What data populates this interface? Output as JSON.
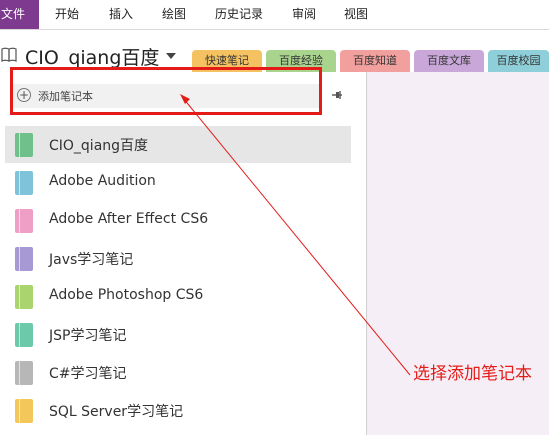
{
  "ribbon": {
    "file": "文件",
    "tabs": [
      "开始",
      "插入",
      "绘图",
      "历史记录",
      "审阅",
      "视图"
    ]
  },
  "notebook": {
    "title": "CIO_qiang百度"
  },
  "sections": [
    {
      "label": "快速笔记",
      "color": "#f5c262"
    },
    {
      "label": "百度经验",
      "color": "#a8d48d"
    },
    {
      "label": "百度知道",
      "color": "#f2a09e"
    },
    {
      "label": "百度文库",
      "color": "#c9a8d9"
    },
    {
      "label": "百度校园",
      "color": "#8fcfd9"
    }
  ],
  "panel": {
    "add_notebook": "添加笔记本",
    "notebooks": [
      {
        "label": "CIO_qiang百度",
        "color": "#6fc08a",
        "selected": true
      },
      {
        "label": "Adobe Audition",
        "color": "#7ec3d9",
        "selected": false
      },
      {
        "label": "Adobe After Effect CS6",
        "color": "#ef9fc6",
        "selected": false
      },
      {
        "label": "Javs学习笔记",
        "color": "#a79ad4",
        "selected": false
      },
      {
        "label": "Adobe Photoshop CS6",
        "color": "#a9d46e",
        "selected": false
      },
      {
        "label": "JSP学习笔记",
        "color": "#6cc9a9",
        "selected": false
      },
      {
        "label": "C#学习笔记",
        "color": "#b7b7b7",
        "selected": false
      },
      {
        "label": "SQL Server学习笔记",
        "color": "#f3c75a",
        "selected": false
      }
    ]
  },
  "annotation": {
    "text": "选择添加笔记本",
    "color": "#e41b17"
  }
}
